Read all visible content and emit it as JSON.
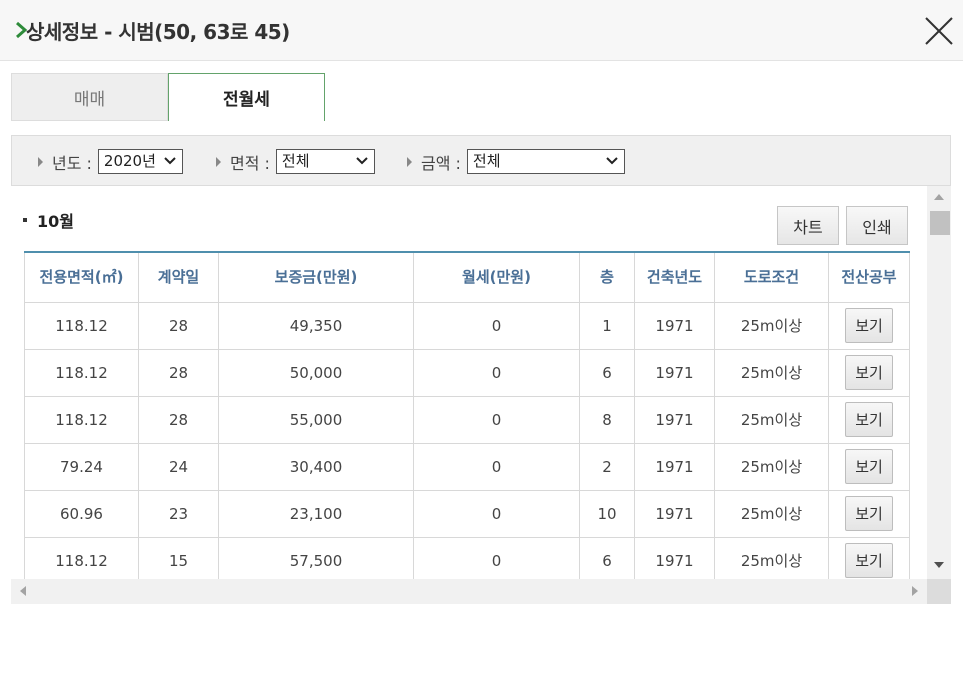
{
  "header": {
    "title": "상세정보 - 시범(50, 63로 45)"
  },
  "tabs": [
    {
      "label": "매매",
      "active": false
    },
    {
      "label": "전월세",
      "active": true
    }
  ],
  "filters": {
    "year": {
      "label": "년도 :",
      "value": "2020년"
    },
    "area": {
      "label": "면적 :",
      "value": "전체"
    },
    "amount": {
      "label": "금액 :",
      "value": "전체"
    }
  },
  "content": {
    "month": "10월",
    "chart_label": "차트",
    "print_label": "인쇄"
  },
  "table": {
    "headers": [
      "전용면적(㎡)",
      "계약일",
      "보증금(만원)",
      "월세(만원)",
      "층",
      "건축년도",
      "도로조건",
      "전산공부"
    ],
    "rows": [
      [
        "118.12",
        "28",
        "49,350",
        "0",
        "1",
        "1971",
        "25m이상",
        "보기"
      ],
      [
        "118.12",
        "28",
        "50,000",
        "0",
        "6",
        "1971",
        "25m이상",
        "보기"
      ],
      [
        "118.12",
        "28",
        "55,000",
        "0",
        "8",
        "1971",
        "25m이상",
        "보기"
      ],
      [
        "79.24",
        "24",
        "30,400",
        "0",
        "2",
        "1971",
        "25m이상",
        "보기"
      ],
      [
        "60.96",
        "23",
        "23,100",
        "0",
        "10",
        "1971",
        "25m이상",
        "보기"
      ],
      [
        "118.12",
        "15",
        "57,500",
        "0",
        "6",
        "1971",
        "25m이상",
        "보기"
      ]
    ]
  },
  "icons": {
    "header": "chevron-right-icon",
    "close": "close-icon",
    "filter_bullet": "triangle-right-icon",
    "select_caret": "chevron-down-icon"
  },
  "colors": {
    "accent_green": "#2e8b3a",
    "tab_border": "#63a36b",
    "table_header_text": "#4a6f96",
    "table_top_border": "#4f8fad"
  }
}
